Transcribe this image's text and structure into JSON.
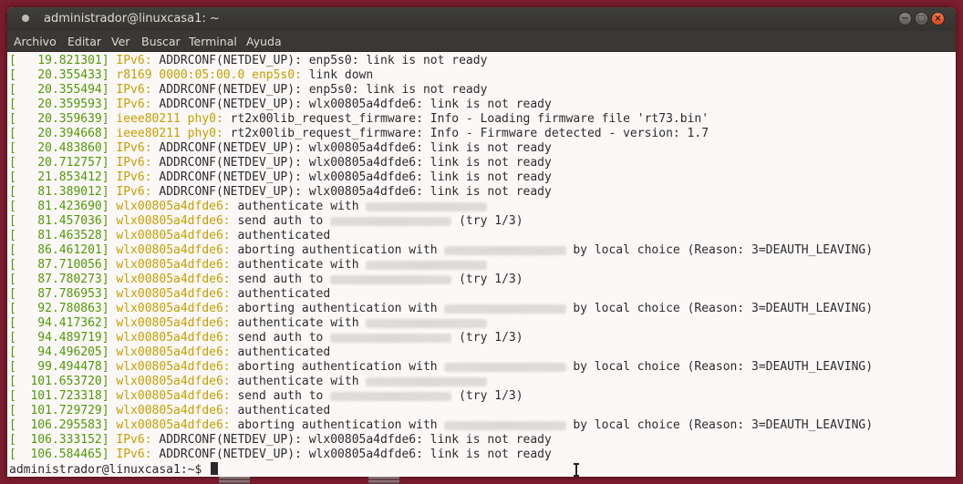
{
  "window": {
    "title": "administrador@linuxcasa1: ~",
    "buttons": {
      "minimize": "−",
      "maximize": "□",
      "close": "×"
    }
  },
  "menu": {
    "items": [
      "Archivo",
      "Editar",
      "Ver",
      "Buscar",
      "Terminal",
      "Ayuda"
    ]
  },
  "colors": {
    "timestamp": "#4e9a06",
    "source": "#c4a000",
    "text": "#2b2b2b",
    "background": "#fdf8f8",
    "titlebar": "#3c3b37",
    "close_button": "#e95420"
  },
  "terminal": {
    "lines": [
      {
        "ts": "[   19.821301]",
        "src": "IPv6:",
        "msg": " ADDRCONF(NETDEV_UP): enp5s0: link is not ready"
      },
      {
        "ts": "[   20.355433]",
        "src": "r8169 0000:05:00.0 enp5s0:",
        "msg": " link down"
      },
      {
        "ts": "[   20.355494]",
        "src": "IPv6:",
        "msg": " ADDRCONF(NETDEV_UP): enp5s0: link is not ready"
      },
      {
        "ts": "[   20.359593]",
        "src": "IPv6:",
        "msg": " ADDRCONF(NETDEV_UP): wlx00805a4dfde6: link is not ready"
      },
      {
        "ts": "[   20.359639]",
        "src": "ieee80211 phy0:",
        "msg": " rt2x00lib_request_firmware: Info - Loading firmware file 'rt73.bin'"
      },
      {
        "ts": "[   20.394668]",
        "src": "ieee80211 phy0:",
        "msg": " rt2x00lib_request_firmware: Info - Firmware detected - version: 1.7"
      },
      {
        "ts": "[   20.483860]",
        "src": "IPv6:",
        "msg": " ADDRCONF(NETDEV_UP): wlx00805a4dfde6: link is not ready"
      },
      {
        "ts": "[   20.712757]",
        "src": "IPv6:",
        "msg": " ADDRCONF(NETDEV_UP): wlx00805a4dfde6: link is not ready"
      },
      {
        "ts": "[   21.853412]",
        "src": "IPv6:",
        "msg": " ADDRCONF(NETDEV_UP): wlx00805a4dfde6: link is not ready"
      },
      {
        "ts": "[   81.389012]",
        "src": "IPv6:",
        "msg": " ADDRCONF(NETDEV_UP): wlx00805a4dfde6: link is not ready"
      },
      {
        "ts": "[   81.423690]",
        "src": "wlx00805a4dfde6:",
        "msg": " authenticate with ",
        "blur": "a2:41:36:94:ad:40",
        "tail": ""
      },
      {
        "ts": "[   81.457036]",
        "src": "wlx00805a4dfde6:",
        "msg": " send auth to ",
        "blur": "a2:41:36:94:ad:40",
        "tail": " (try 1/3)"
      },
      {
        "ts": "[   81.463528]",
        "src": "wlx00805a4dfde6:",
        "msg": " authenticated"
      },
      {
        "ts": "[   86.461201]",
        "src": "wlx00805a4dfde6:",
        "msg": " aborting authentication with ",
        "blur": "a2:41:36:94:ad:40",
        "tail": " by local choice (Reason: 3=DEAUTH_LEAVING)"
      },
      {
        "ts": "[   87.710056]",
        "src": "wlx00805a4dfde6:",
        "msg": " authenticate with ",
        "blur": "a2:41:36:94:ad:40",
        "tail": ""
      },
      {
        "ts": "[   87.780273]",
        "src": "wlx00805a4dfde6:",
        "msg": " send auth to ",
        "blur": "a2:41:36:94:ad:40",
        "tail": " (try 1/3)"
      },
      {
        "ts": "[   87.786953]",
        "src": "wlx00805a4dfde6:",
        "msg": " authenticated"
      },
      {
        "ts": "[   92.780863]",
        "src": "wlx00805a4dfde6:",
        "msg": " aborting authentication with ",
        "blur": "a2:41:36:94:ad:40",
        "tail": " by local choice (Reason: 3=DEAUTH_LEAVING)"
      },
      {
        "ts": "[   94.417362]",
        "src": "wlx00805a4dfde6:",
        "msg": " authenticate with ",
        "blur": "a2:41:36:94:ad:40",
        "tail": ""
      },
      {
        "ts": "[   94.489719]",
        "src": "wlx00805a4dfde6:",
        "msg": " send auth to ",
        "blur": "a2:41:36:94:ad:40",
        "tail": " (try 1/3)"
      },
      {
        "ts": "[   94.496205]",
        "src": "wlx00805a4dfde6:",
        "msg": " authenticated"
      },
      {
        "ts": "[   99.494478]",
        "src": "wlx00805a4dfde6:",
        "msg": " aborting authentication with ",
        "blur": "a2:41:36:94:ad:40",
        "tail": " by local choice (Reason: 3=DEAUTH_LEAVING)"
      },
      {
        "ts": "[  101.653720]",
        "src": "wlx00805a4dfde6:",
        "msg": " authenticate with ",
        "blur": "a2:41:36:94:ad:40",
        "tail": ""
      },
      {
        "ts": "[  101.723318]",
        "src": "wlx00805a4dfde6:",
        "msg": " send auth to ",
        "blur": "a2:41:36:94:ad:40",
        "tail": " (try 1/3)"
      },
      {
        "ts": "[  101.729729]",
        "src": "wlx00805a4dfde6:",
        "msg": " authenticated"
      },
      {
        "ts": "[  106.295583]",
        "src": "wlx00805a4dfde6:",
        "msg": " aborting authentication with ",
        "blur": "a2:41:36:94:ad:40",
        "tail": " by local choice (Reason: 3=DEAUTH_LEAVING)"
      },
      {
        "ts": "[  106.333152]",
        "src": "IPv6:",
        "msg": " ADDRCONF(NETDEV_UP): wlx00805a4dfde6: link is not ready"
      },
      {
        "ts": "[  106.584465]",
        "src": "IPv6:",
        "msg": " ADDRCONF(NETDEV_UP): wlx00805a4dfde6: link is not ready"
      }
    ],
    "prompt": "administrador@linuxcasa1:~$ "
  }
}
